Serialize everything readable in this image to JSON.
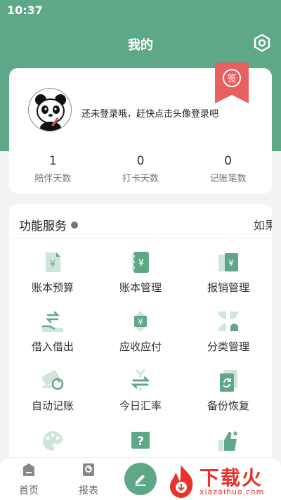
{
  "status": {
    "time": "10:37"
  },
  "header": {
    "title": "我的"
  },
  "profile": {
    "login_tip": "还未登录哦，赶快点击头像登录吧",
    "badge": "签",
    "stats": [
      {
        "value": "1",
        "label": "陪伴天数"
      },
      {
        "value": "0",
        "label": "打卡天数"
      },
      {
        "value": "0",
        "label": "记账笔数"
      }
    ]
  },
  "services": {
    "title": "功能服务",
    "right_text": "如果",
    "items": [
      {
        "label": "账本预算",
        "icon": "budget-icon"
      },
      {
        "label": "账本管理",
        "icon": "ledger-manage-icon"
      },
      {
        "label": "报销管理",
        "icon": "reimburse-icon"
      },
      {
        "label": "借入借出",
        "icon": "lend-borrow-icon"
      },
      {
        "label": "应收应付",
        "icon": "receivable-payable-icon"
      },
      {
        "label": "分类管理",
        "icon": "category-icon"
      },
      {
        "label": "自动记账",
        "icon": "auto-record-icon"
      },
      {
        "label": "今日汇率",
        "icon": "exchange-rate-icon"
      },
      {
        "label": "备份恢复",
        "icon": "backup-restore-icon"
      },
      {
        "label": "",
        "icon": "palette-icon"
      },
      {
        "label": "",
        "icon": "help-icon"
      },
      {
        "label": "",
        "icon": "thumbs-up-icon"
      }
    ]
  },
  "tabbar": {
    "items": [
      {
        "label": "首页",
        "icon": "home-icon"
      },
      {
        "label": "报表",
        "icon": "report-icon"
      }
    ]
  },
  "watermark": {
    "text": "下载火",
    "url": "xiazaihuo.com"
  },
  "colors": {
    "accent": "#5fa887",
    "icon_green": "#5fa887",
    "icon_light": "#cfe5da",
    "watermark_red": "#e8332a"
  }
}
